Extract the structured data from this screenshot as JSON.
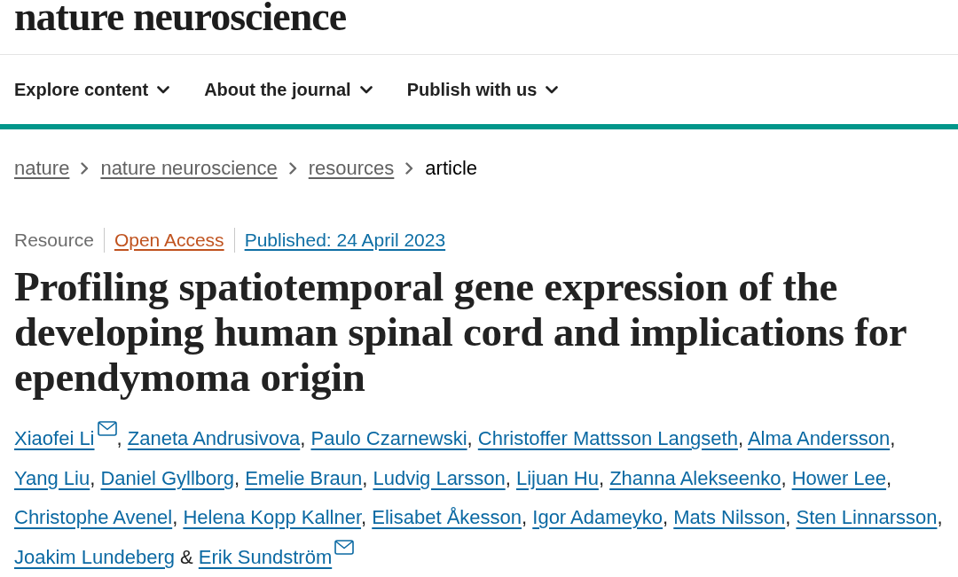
{
  "header": {
    "logo": "nature neuroscience"
  },
  "nav": [
    {
      "label": "Explore content"
    },
    {
      "label": "About the journal"
    },
    {
      "label": "Publish with us"
    }
  ],
  "breadcrumbs": [
    {
      "label": "nature",
      "kind": "link"
    },
    {
      "label": "nature neuroscience",
      "kind": "link"
    },
    {
      "label": "resources",
      "kind": "link"
    },
    {
      "label": "article",
      "kind": "current"
    }
  ],
  "article": {
    "meta": [
      {
        "label": "Resource",
        "kind": "type"
      },
      {
        "label": "Open Access",
        "kind": "access"
      },
      {
        "label": "Published: 24 April 2023",
        "kind": "date"
      }
    ],
    "title": "Profiling spatiotemporal gene expression of the developing human spinal cord and implications for ependymoma origin",
    "authors": [
      {
        "name": "Xiaofei Li",
        "corresponding": true,
        "separator": {
          "kind": "comma",
          "text": ","
        }
      },
      {
        "name": "Zaneta Andrusivova",
        "separator": {
          "kind": "comma",
          "text": ","
        }
      },
      {
        "name": "Paulo Czarnewski",
        "separator": {
          "kind": "comma",
          "text": ","
        }
      },
      {
        "name": "Christoffer Mattsson Langseth",
        "separator": {
          "kind": "comma",
          "text": ","
        }
      },
      {
        "name": "Alma Andersson",
        "separator": {
          "kind": "comma",
          "text": ","
        }
      },
      {
        "name": "Yang Liu",
        "separator": {
          "kind": "comma",
          "text": ","
        }
      },
      {
        "name": "Daniel Gyllborg",
        "separator": {
          "kind": "comma",
          "text": ","
        }
      },
      {
        "name": "Emelie Braun",
        "separator": {
          "kind": "comma",
          "text": ","
        }
      },
      {
        "name": "Ludvig Larsson",
        "separator": {
          "kind": "comma",
          "text": ","
        }
      },
      {
        "name": "Lijuan Hu",
        "separator": {
          "kind": "comma",
          "text": ","
        }
      },
      {
        "name": "Zhanna Alekseenko",
        "separator": {
          "kind": "comma",
          "text": ","
        }
      },
      {
        "name": "Hower Lee",
        "separator": {
          "kind": "comma",
          "text": ","
        }
      },
      {
        "name": "Christophe Avenel",
        "separator": {
          "kind": "comma",
          "text": ","
        }
      },
      {
        "name": "Helena Kopp Kallner",
        "separator": {
          "kind": "comma",
          "text": ","
        }
      },
      {
        "name": "Elisabet Åkesson",
        "separator": {
          "kind": "comma",
          "text": ","
        }
      },
      {
        "name": "Igor Adameyko",
        "separator": {
          "kind": "comma",
          "text": ","
        }
      },
      {
        "name": "Mats Nilsson",
        "separator": {
          "kind": "comma",
          "text": ","
        }
      },
      {
        "name": "Sten Linnarsson",
        "separator": {
          "kind": "comma",
          "text": ","
        }
      },
      {
        "name": "Joakim Lundeberg",
        "separator": {
          "kind": "conjunction",
          "text": "&"
        }
      },
      {
        "name": "Erik Sundström",
        "corresponding": true
      }
    ]
  }
}
